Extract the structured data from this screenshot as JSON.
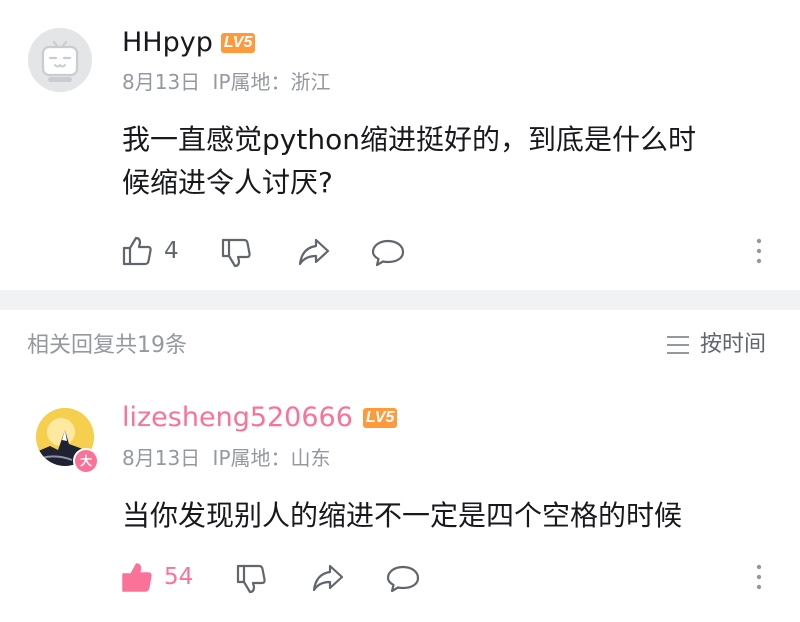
{
  "comments": [
    {
      "username": "HHpyp",
      "level": "LV5",
      "level_color": "#ff9a3c",
      "date": "8月13日",
      "ip_label": "IP属地：浙江",
      "text_line1": "我一直感觉python缩进挺好的，到底是什么时",
      "text_line2": "候缩进令人讨厌?",
      "likes": "4",
      "liked": false,
      "avatar_icon": "tv-mascot-placeholder"
    }
  ],
  "replies_header": {
    "count_label": "相关回复共19条",
    "sort_label": "按时间",
    "sort_icon": "menu-lines-icon"
  },
  "replies": [
    {
      "username": "lizesheng520666",
      "username_color": "#fb7299",
      "level": "LV5",
      "level_color": "#ff9a3c",
      "date": "8月13日",
      "ip_label": "IP属地：山东",
      "text": "当你发现别人的缩进不一定是四个空格的时候",
      "likes": "54",
      "liked": true,
      "badge": "大",
      "accent_color": "#fb7299"
    }
  ]
}
